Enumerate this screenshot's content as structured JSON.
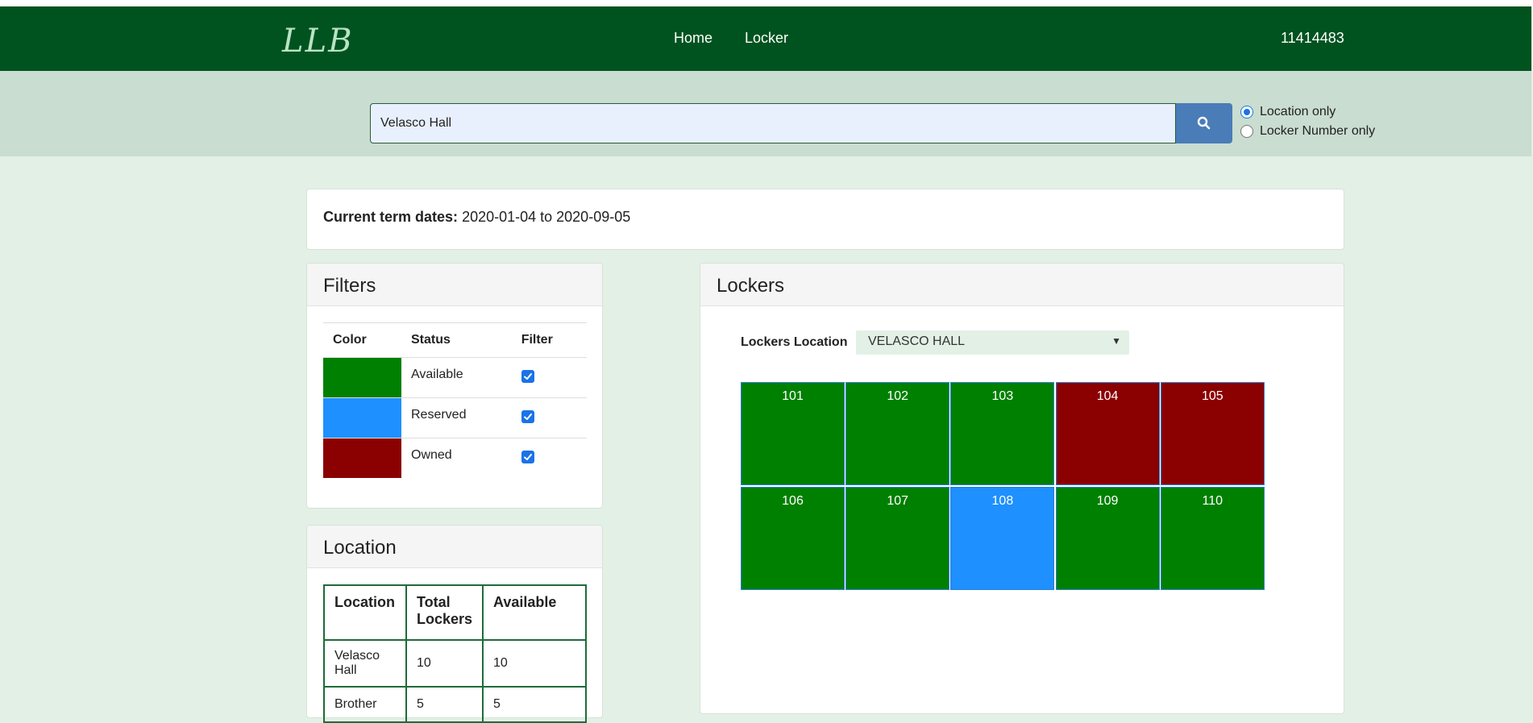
{
  "nav": {
    "logo": "LLB",
    "links": [
      "Home",
      "Locker"
    ],
    "user_id": "11414483"
  },
  "search": {
    "value": "Velasco Hall",
    "icon": "search-icon",
    "options": [
      {
        "label": "Location only",
        "checked": true
      },
      {
        "label": "Locker Number only",
        "checked": false
      }
    ]
  },
  "term": {
    "label": "Current term dates:",
    "value": "2020-01-04 to 2020-09-05"
  },
  "filters": {
    "title": "Filters",
    "headers": [
      "Color",
      "Status",
      "Filter"
    ],
    "rows": [
      {
        "color": "#008000",
        "status": "Available",
        "checked": true
      },
      {
        "color": "#1e90ff",
        "status": "Reserved",
        "checked": true
      },
      {
        "color": "#8b0000",
        "status": "Owned",
        "checked": true
      }
    ]
  },
  "location": {
    "title": "Location",
    "headers": [
      "Location",
      "Total Lockers",
      "Available"
    ],
    "rows": [
      [
        "Velasco Hall",
        "10",
        "10"
      ],
      [
        "Brother",
        "5",
        "5"
      ]
    ]
  },
  "lockers": {
    "title": "Lockers",
    "location_label": "Lockers Location",
    "location_value": "VELASCO HALL",
    "items": [
      {
        "number": "101",
        "color": "#008000"
      },
      {
        "number": "102",
        "color": "#008000"
      },
      {
        "number": "103",
        "color": "#008000"
      },
      {
        "number": "104",
        "color": "#8b0000"
      },
      {
        "number": "105",
        "color": "#8b0000"
      },
      {
        "number": "106",
        "color": "#008000"
      },
      {
        "number": "107",
        "color": "#008000"
      },
      {
        "number": "108",
        "color": "#1e90ff"
      },
      {
        "number": "109",
        "color": "#008000"
      },
      {
        "number": "110",
        "color": "#008000"
      }
    ]
  }
}
